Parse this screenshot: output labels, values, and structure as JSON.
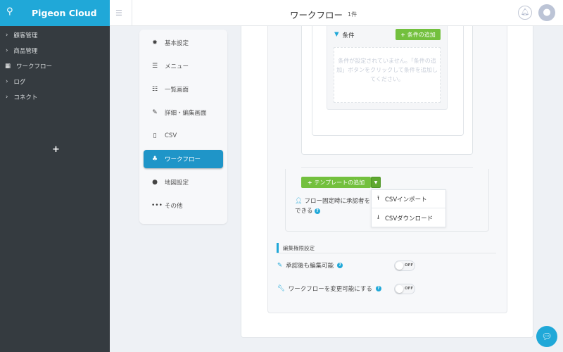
{
  "app": {
    "name": "Pigeon Cloud"
  },
  "sidebar": {
    "items": [
      {
        "label": "顧客管理",
        "icon": "chevron-right-icon"
      },
      {
        "label": "商品管理",
        "icon": "chevron-right-icon"
      },
      {
        "label": "ワークフロー",
        "icon": "table-icon"
      },
      {
        "label": "ログ",
        "icon": "chevron-right-icon"
      },
      {
        "label": "コネクト",
        "icon": "chevron-right-icon"
      }
    ],
    "add": "+"
  },
  "header": {
    "title": "ワークフロー",
    "count": "1件"
  },
  "settings_menu": {
    "items": [
      {
        "label": "基本設定",
        "icon": "gear-icon"
      },
      {
        "label": "メニュー",
        "icon": "menu-icon"
      },
      {
        "label": "一覧画面",
        "icon": "list-icon"
      },
      {
        "label": "詳細・編集画面",
        "icon": "edit-icon"
      },
      {
        "label": "CSV",
        "icon": "csv-file-icon"
      },
      {
        "label": "ワークフロー",
        "icon": "sitemap-icon",
        "active": true
      },
      {
        "label": "地図設定",
        "icon": "map-marker-icon"
      },
      {
        "label": "その他",
        "icon": "ellipsis-icon"
      }
    ]
  },
  "conditions": {
    "label": "条件",
    "add_button": "条件の追加",
    "empty_message": "条件が設定されていません。「条件の追加」ボタンをクリックして条件を追加してください。"
  },
  "template": {
    "add_button": "テンプレートの追加",
    "dropdown": [
      {
        "label": "CSVインポート",
        "icon": "upload-icon"
      },
      {
        "label": "CSVダウンロード",
        "icon": "download-icon"
      }
    ],
    "fixed_flow_text": "フロー固定時に承認者を",
    "fixed_flow_text2": "できる"
  },
  "permissions": {
    "title": "編集権限設定",
    "options": [
      {
        "label": "承認後も編集可能",
        "value": "OFF"
      },
      {
        "label": "ワークフローを変更可能にする",
        "value": "OFF"
      }
    ]
  },
  "colors": {
    "brand": "#20a8d8",
    "sidebar": "#353b40",
    "green": "#73c03e"
  }
}
